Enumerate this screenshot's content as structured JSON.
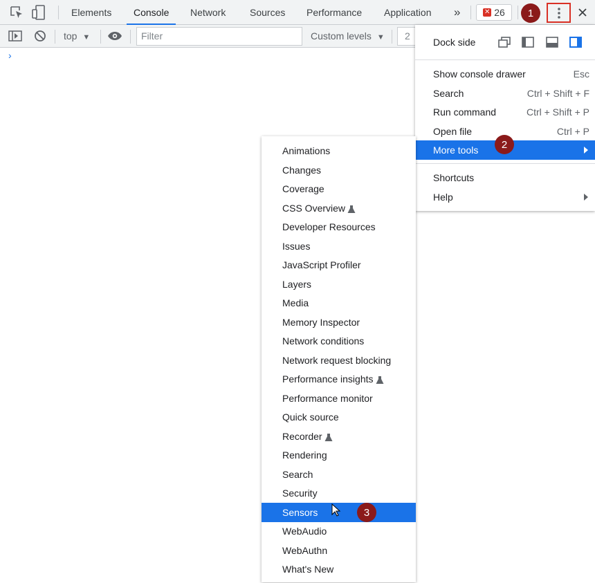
{
  "tabs": [
    {
      "label": "Elements",
      "active": false
    },
    {
      "label": "Console",
      "active": true
    },
    {
      "label": "Network",
      "active": false
    },
    {
      "label": "Sources",
      "active": false
    },
    {
      "label": "Performance",
      "active": false
    },
    {
      "label": "Application",
      "active": false
    }
  ],
  "more_tabs_label": "»",
  "issues_count": "26",
  "toolbar": {
    "context": "top",
    "filter_placeholder": "Filter",
    "levels": "Custom levels",
    "partial_count": "2"
  },
  "step_markers": [
    "1",
    "2",
    "3"
  ],
  "main_menu": {
    "dock_side_label": "Dock side",
    "items": [
      {
        "label": "Show console drawer",
        "shortcut": "Esc"
      },
      {
        "label": "Search",
        "shortcut": "Ctrl + Shift + F"
      },
      {
        "label": "Run command",
        "shortcut": "Ctrl + Shift + P"
      },
      {
        "label": "Open file",
        "shortcut": "Ctrl + P"
      },
      {
        "label": "More tools",
        "shortcut": ""
      }
    ],
    "shortcuts_label": "Shortcuts",
    "help_label": "Help"
  },
  "more_tools": [
    "Animations",
    "Changes",
    "Coverage",
    "CSS Overview",
    "Developer Resources",
    "Issues",
    "JavaScript Profiler",
    "Layers",
    "Media",
    "Memory Inspector",
    "Network conditions",
    "Network request blocking",
    "Performance insights",
    "Performance monitor",
    "Quick source",
    "Recorder",
    "Rendering",
    "Search",
    "Security",
    "Sensors",
    "WebAudio",
    "WebAuthn",
    "What's New"
  ],
  "experimental_items": [
    "CSS Overview",
    "Performance insights",
    "Recorder"
  ],
  "selected_tool": "Sensors",
  "colors": {
    "accent": "#1a73e8",
    "marker": "#8b1a1a",
    "highlight_border": "#d93025"
  }
}
